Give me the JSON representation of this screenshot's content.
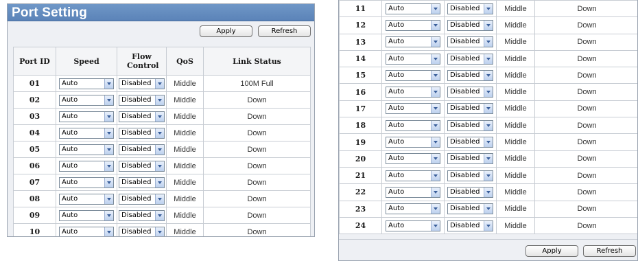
{
  "title": "Port Setting",
  "buttons": {
    "apply": "Apply",
    "refresh": "Refresh"
  },
  "columns": {
    "port_id": "Port ID",
    "speed": "Speed",
    "flow_control": "Flow Control",
    "qos": "QoS",
    "link_status": "Link Status"
  },
  "ports": [
    {
      "id": "01",
      "speed": "Auto",
      "flow_control": "Disabled",
      "qos": "Middle",
      "link_status": "100M Full"
    },
    {
      "id": "02",
      "speed": "Auto",
      "flow_control": "Disabled",
      "qos": "Middle",
      "link_status": "Down"
    },
    {
      "id": "03",
      "speed": "Auto",
      "flow_control": "Disabled",
      "qos": "Middle",
      "link_status": "Down"
    },
    {
      "id": "04",
      "speed": "Auto",
      "flow_control": "Disabled",
      "qos": "Middle",
      "link_status": "Down"
    },
    {
      "id": "05",
      "speed": "Auto",
      "flow_control": "Disabled",
      "qos": "Middle",
      "link_status": "Down"
    },
    {
      "id": "06",
      "speed": "Auto",
      "flow_control": "Disabled",
      "qos": "Middle",
      "link_status": "Down"
    },
    {
      "id": "07",
      "speed": "Auto",
      "flow_control": "Disabled",
      "qos": "Middle",
      "link_status": "Down"
    },
    {
      "id": "08",
      "speed": "Auto",
      "flow_control": "Disabled",
      "qos": "Middle",
      "link_status": "Down"
    },
    {
      "id": "09",
      "speed": "Auto",
      "flow_control": "Disabled",
      "qos": "Middle",
      "link_status": "Down"
    },
    {
      "id": "10",
      "speed": "Auto",
      "flow_control": "Disabled",
      "qos": "Middle",
      "link_status": "Down"
    },
    {
      "id": "11",
      "speed": "Auto",
      "flow_control": "Disabled",
      "qos": "Middle",
      "link_status": "Down"
    },
    {
      "id": "12",
      "speed": "Auto",
      "flow_control": "Disabled",
      "qos": "Middle",
      "link_status": "Down"
    },
    {
      "id": "13",
      "speed": "Auto",
      "flow_control": "Disabled",
      "qos": "Middle",
      "link_status": "Down"
    },
    {
      "id": "14",
      "speed": "Auto",
      "flow_control": "Disabled",
      "qos": "Middle",
      "link_status": "Down"
    },
    {
      "id": "15",
      "speed": "Auto",
      "flow_control": "Disabled",
      "qos": "Middle",
      "link_status": "Down"
    },
    {
      "id": "16",
      "speed": "Auto",
      "flow_control": "Disabled",
      "qos": "Middle",
      "link_status": "Down"
    },
    {
      "id": "17",
      "speed": "Auto",
      "flow_control": "Disabled",
      "qos": "Middle",
      "link_status": "Down"
    },
    {
      "id": "18",
      "speed": "Auto",
      "flow_control": "Disabled",
      "qos": "Middle",
      "link_status": "Down"
    },
    {
      "id": "19",
      "speed": "Auto",
      "flow_control": "Disabled",
      "qos": "Middle",
      "link_status": "Down"
    },
    {
      "id": "20",
      "speed": "Auto",
      "flow_control": "Disabled",
      "qos": "Middle",
      "link_status": "Down"
    },
    {
      "id": "21",
      "speed": "Auto",
      "flow_control": "Disabled",
      "qos": "Middle",
      "link_status": "Down"
    },
    {
      "id": "22",
      "speed": "Auto",
      "flow_control": "Disabled",
      "qos": "Middle",
      "link_status": "Down"
    },
    {
      "id": "23",
      "speed": "Auto",
      "flow_control": "Disabled",
      "qos": "Middle",
      "link_status": "Down"
    },
    {
      "id": "24",
      "speed": "Auto",
      "flow_control": "Disabled",
      "qos": "Middle",
      "link_status": "Down"
    }
  ],
  "icons": {
    "dropdown": "chevron-down-icon"
  },
  "colors": {
    "title_bar": "#6f97c7",
    "panel_bg": "#eef0f4",
    "border": "#c7ccd3"
  }
}
